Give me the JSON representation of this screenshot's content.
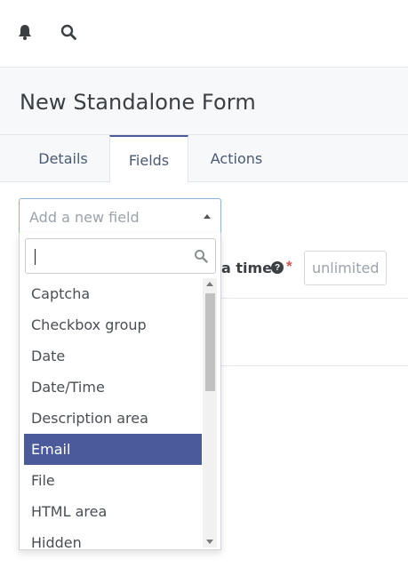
{
  "topbar": {
    "icons": [
      "bell-icon",
      "search-icon"
    ]
  },
  "page": {
    "title": "New Standalone Form"
  },
  "tabs": [
    {
      "label": "Details",
      "active": false
    },
    {
      "label": "Fields",
      "active": true
    },
    {
      "label": "Actions",
      "active": false
    }
  ],
  "field_select": {
    "placeholder": "Add a new field"
  },
  "dropdown": {
    "search_value": "",
    "options": [
      {
        "label": "Captcha"
      },
      {
        "label": "Checkbox group"
      },
      {
        "label": "Date"
      },
      {
        "label": "Date/Time"
      },
      {
        "label": "Description area"
      },
      {
        "label": "Email",
        "highlighted": true
      },
      {
        "label": "File"
      },
      {
        "label": "HTML area"
      },
      {
        "label": "Hidden"
      }
    ]
  },
  "background_field": {
    "label": "a time",
    "required_marker": "*",
    "value_placeholder": "unlimited"
  },
  "colors": {
    "accent": "#4b5a9b",
    "required": "#d9534f",
    "focus_border": "#8ab4e0"
  }
}
